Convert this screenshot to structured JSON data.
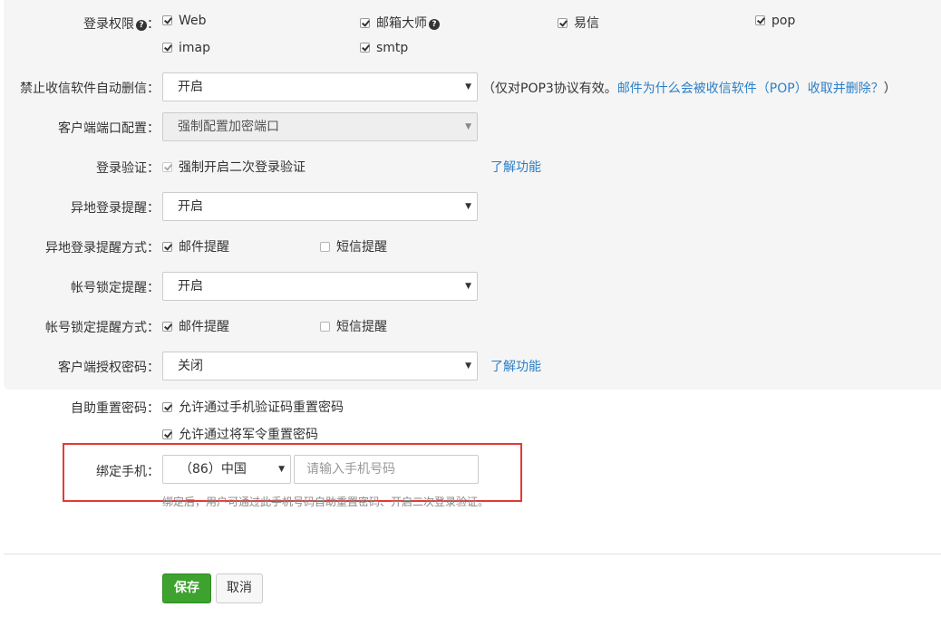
{
  "login_permission": {
    "label": "登录权限",
    "options": [
      {
        "label": "Web",
        "checked": true
      },
      {
        "label": "邮箱大师",
        "checked": true
      },
      {
        "label": "易信",
        "checked": true
      },
      {
        "label": "pop",
        "checked": true
      },
      {
        "label": "imap",
        "checked": true
      },
      {
        "label": "smtp",
        "checked": true
      }
    ]
  },
  "no_auto_delete": {
    "label": "禁止收信软件自动删信",
    "value": "开启",
    "note": "（仅对POP3协议有效。",
    "note_link": "邮件为什么会被收信软件（POP）收取并删除？",
    "note_end": "）"
  },
  "client_port": {
    "label": "客户端端口配置",
    "value": "强制配置加密端口"
  },
  "login_verify": {
    "label": "登录验证",
    "option": "强制开启二次登录验证",
    "link": "了解功能"
  },
  "remote_login_alert": {
    "label": "异地登录提醒",
    "value": "开启"
  },
  "remote_login_method": {
    "label": "异地登录提醒方式",
    "email": "邮件提醒",
    "sms": "短信提醒"
  },
  "lock_alert": {
    "label": "帐号锁定提醒",
    "value": "开启"
  },
  "lock_alert_method": {
    "label": "帐号锁定提醒方式",
    "email": "邮件提醒",
    "sms": "短信提醒"
  },
  "client_auth_password": {
    "label": "客户端授权密码",
    "value": "关闭",
    "link": "了解功能"
  },
  "self_reset": {
    "label": "自助重置密码",
    "opt_phone": "允许通过手机验证码重置密码",
    "opt_token": "允许通过将军令重置密码"
  },
  "bind_phone": {
    "label": "绑定手机",
    "country": "（86）中国",
    "placeholder": "请输入手机号码",
    "hint": "绑定后，用户可通过此手机号码自助重置密码、开启二次登录验证。"
  },
  "actions": {
    "save": "保存",
    "cancel": "取消"
  },
  "colon": "："
}
